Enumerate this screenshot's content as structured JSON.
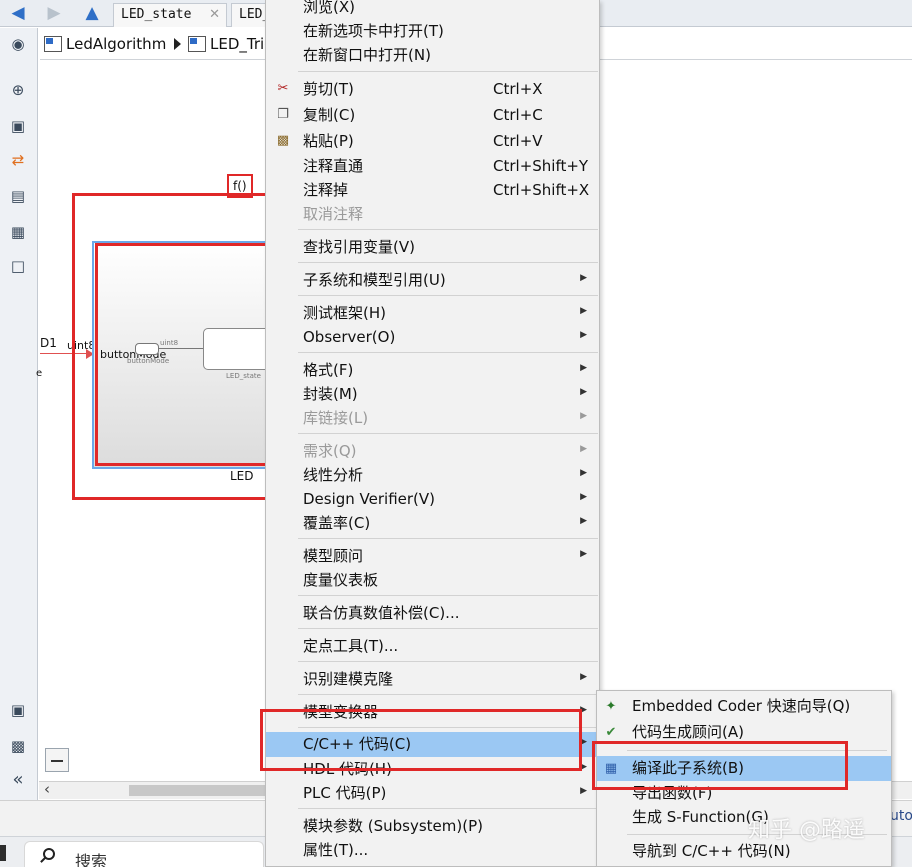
{
  "tabs": [
    {
      "label": "LED_state"
    },
    {
      "label": "LED_"
    }
  ],
  "breadcrumb": [
    {
      "label": "LedAlgorithm"
    },
    {
      "label": "LED_Trig"
    }
  ],
  "diagram": {
    "fcall_label": "f()",
    "input_port_label": "D1",
    "signal_type": "uint8",
    "subsystem_port_label": "buttonMode",
    "small_signal_type": "uint8",
    "small_port_label": "buttonMode",
    "inner_block_label": "LED_state",
    "subsystem_name": "LED",
    "cut_letter": "e"
  },
  "context_menu": {
    "items": [
      {
        "label": "浏览(X)"
      },
      {
        "label": "在新选项卡中打开(T)"
      },
      {
        "label": "在新窗口中打开(N)"
      },
      {
        "label": "剪切(T)",
        "shortcut": "Ctrl+X",
        "icon": "scissors-icon"
      },
      {
        "label": "复制(C)",
        "shortcut": "Ctrl+C",
        "icon": "copy-icon"
      },
      {
        "label": "粘贴(P)",
        "shortcut": "Ctrl+V",
        "icon": "paste-icon"
      },
      {
        "label": "注释直通",
        "shortcut": "Ctrl+Shift+Y"
      },
      {
        "label": "注释掉",
        "shortcut": "Ctrl+Shift+X"
      },
      {
        "label": "取消注释",
        "disabled": true
      },
      {
        "label": "查找引用变量(V)"
      },
      {
        "label": "子系统和模型引用(U)",
        "submenu": true
      },
      {
        "label": "测试框架(H)",
        "submenu": true
      },
      {
        "label": "Observer(O)",
        "submenu": true
      },
      {
        "label": "格式(F)",
        "submenu": true
      },
      {
        "label": "封装(M)",
        "submenu": true
      },
      {
        "label": "库链接(L)",
        "submenu": true,
        "disabled": true
      },
      {
        "label": "需求(Q)",
        "submenu": true,
        "disabled": true
      },
      {
        "label": "线性分析",
        "submenu": true
      },
      {
        "label": "Design Verifier(V)",
        "submenu": true
      },
      {
        "label": "覆盖率(C)",
        "submenu": true
      },
      {
        "label": "模型顾问",
        "submenu": true
      },
      {
        "label": "度量仪表板"
      },
      {
        "label": "联合仿真数值补偿(C)..."
      },
      {
        "label": "定点工具(T)..."
      },
      {
        "label": "识别建模克隆",
        "submenu": true
      },
      {
        "label": "模型变换器",
        "submenu": true
      },
      {
        "label": "C/C++ 代码(C)",
        "submenu": true,
        "highlighted": true
      },
      {
        "label": "HDL 代码(H)",
        "submenu": true
      },
      {
        "label": "PLC 代码(P)",
        "submenu": true
      },
      {
        "label": "模块参数 (Subsystem)(P)"
      },
      {
        "label": "属性(T)..."
      }
    ]
  },
  "submenu": {
    "items": [
      {
        "label": "Embedded Coder 快速向导(Q)",
        "icon": "wizard-icon"
      },
      {
        "label": "代码生成顾问(A)",
        "icon": "advisor-check-icon"
      },
      {
        "label": "编译此子系统(B)",
        "icon": "build-icon",
        "highlighted": true
      },
      {
        "label": "导出函数(F)"
      },
      {
        "label": "生成 S-Function(G)"
      },
      {
        "label": "导航到 C/C++ 代码(N)"
      }
    ]
  },
  "taskbar": {
    "search_label": "搜索"
  },
  "watermark": "知乎 @路遥",
  "edge_text": "uto",
  "colors": {
    "highlight": "#9bc8f3",
    "annotation_red": "#e02828",
    "signal": "#e05050"
  }
}
